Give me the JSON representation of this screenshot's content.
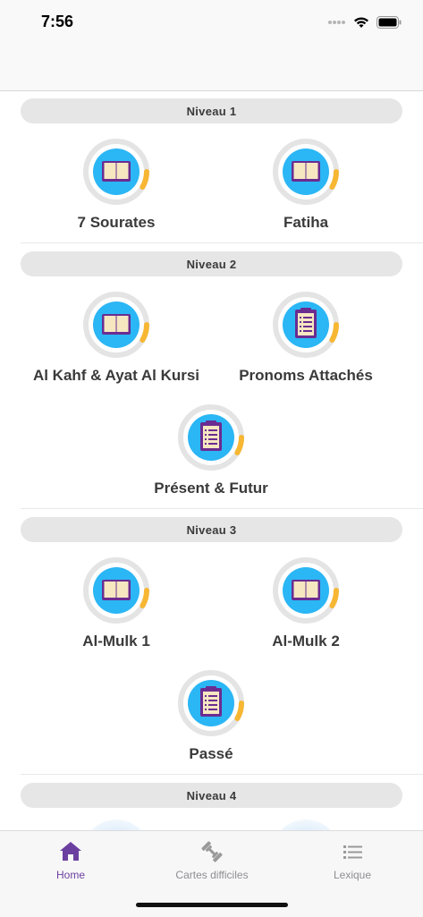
{
  "status_bar": {
    "time": "7:56"
  },
  "levels": [
    {
      "title": "Niveau  1",
      "lessons": [
        {
          "label": "7 Sourates",
          "icon": "book-icon",
          "progress": 0.12
        },
        {
          "label": "Fatiha",
          "icon": "book-icon",
          "progress": 0.12
        }
      ]
    },
    {
      "title": "Niveau  2",
      "lessons": [
        {
          "label": "Al Kahf & Ayat Al Kursi",
          "icon": "book-icon",
          "progress": 0.12
        },
        {
          "label": "Pronoms Attachés",
          "icon": "clipboard-icon",
          "progress": 0.12
        },
        {
          "label": "Présent & Futur",
          "icon": "clipboard-icon",
          "progress": 0.12
        }
      ]
    },
    {
      "title": "Niveau  3",
      "lessons": [
        {
          "label": "Al-Mulk 1",
          "icon": "book-icon",
          "progress": 0.12
        },
        {
          "label": "Al-Mulk 2",
          "icon": "book-icon",
          "progress": 0.12
        },
        {
          "label": "Passé",
          "icon": "clipboard-icon",
          "progress": 0.12
        }
      ]
    },
    {
      "title": "Niveau  4",
      "lessons": []
    }
  ],
  "tabs": [
    {
      "label": "Home",
      "icon": "home-icon",
      "active": true
    },
    {
      "label": "Cartes difficiles",
      "icon": "dumbbell-icon",
      "active": false
    },
    {
      "label": "Lexique",
      "icon": "list-icon",
      "active": false
    }
  ],
  "colors": {
    "accent": "#6b3fa0",
    "ring_track": "#e4e4e4",
    "ring_progress": "#f7b733",
    "icon_circle": "#2bb6f5",
    "book_cover": "#6b2c91",
    "book_page": "#f6e7c1",
    "clipboard": "#6b2c91"
  }
}
